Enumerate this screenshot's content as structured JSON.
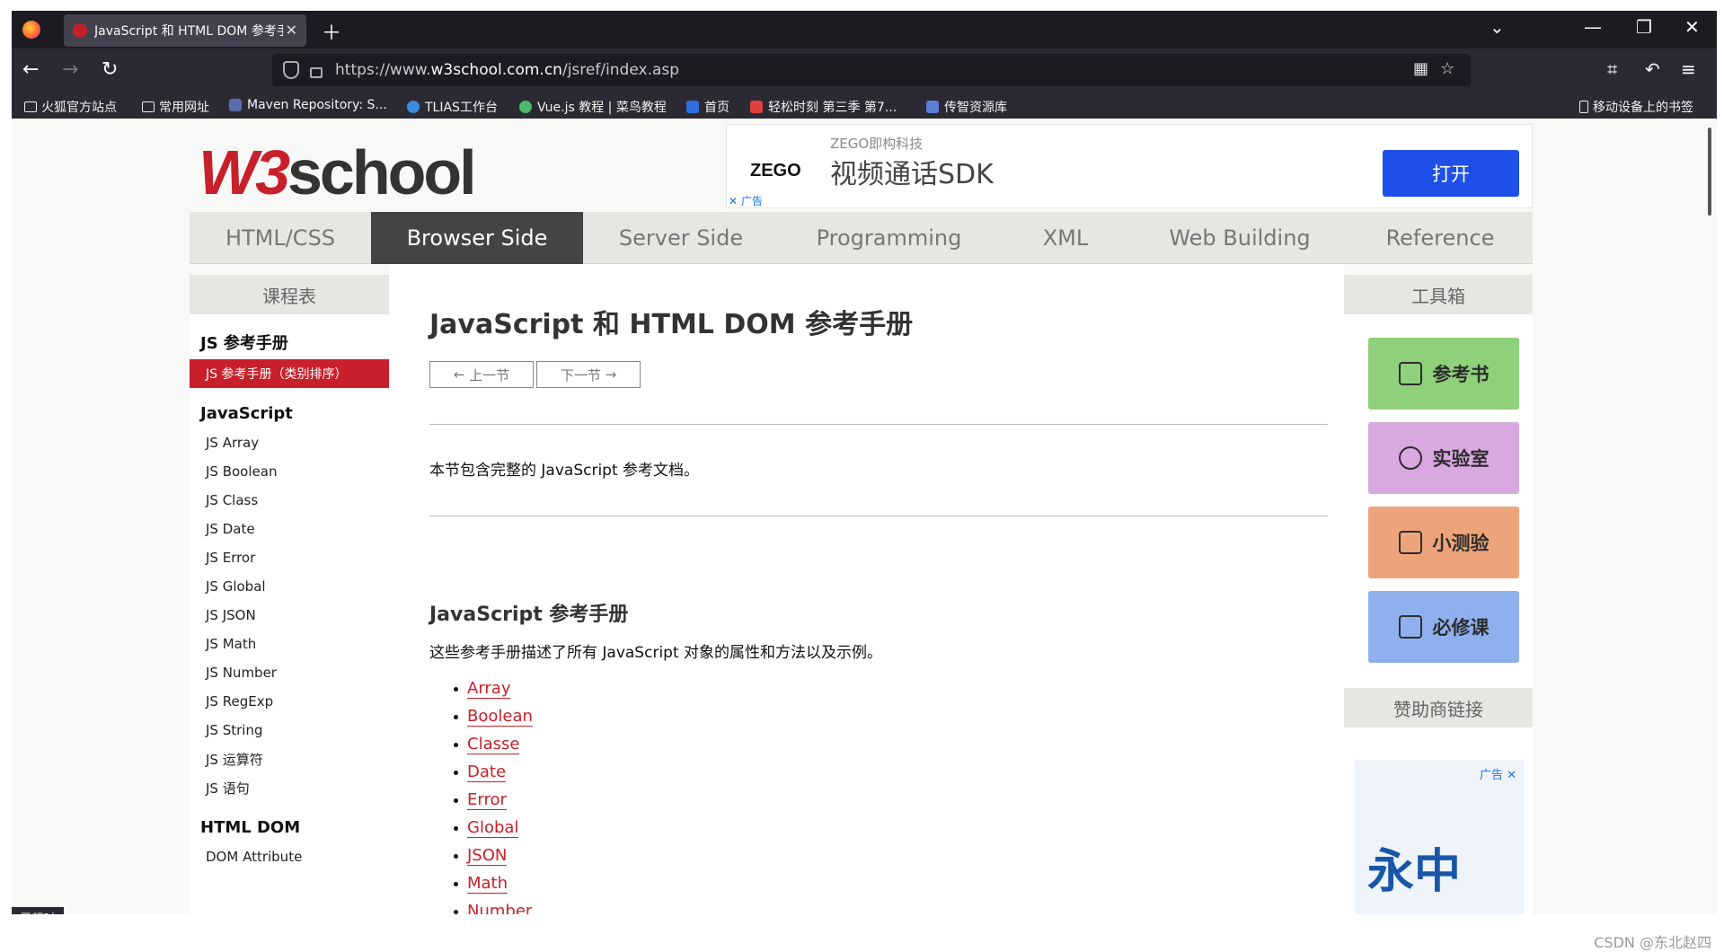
{
  "browser": {
    "tab_title": "JavaScript 和 HTML DOM 参考手册",
    "url_prefix": "https://www.",
    "url_domain": "w3school.com.cn",
    "url_path": "/jsref/index.asp",
    "bookmarks": [
      "火狐官方站点",
      "常用网址",
      "Maven Repository: S...",
      "TLIAS工作台",
      "Vue.js 教程 | 菜鸟教程",
      "首页",
      "轻松时刻 第三季 第7...",
      "传智资源库"
    ],
    "mobile_bookmarks": "移动设备上的书签",
    "colors": {
      "tabbar": "#1c1b22",
      "toolbar": "#2b2a33"
    }
  },
  "site": {
    "logo_w3": "W3",
    "logo_school": "school",
    "nav": [
      "HTML/CSS",
      "Browser Side",
      "Server Side",
      "Programming",
      "XML",
      "Web Building",
      "Reference"
    ],
    "nav_active": "Browser Side",
    "accent": "#c8202a"
  },
  "ad": {
    "logo": "ZEGO",
    "brand": "ZEGO即构科技",
    "slogan": "视频通话SDK",
    "button": "打开",
    "mark": "广告"
  },
  "left_sidebar": {
    "title": "课程表",
    "section1": "JS 参考手册",
    "highlight": "JS 参考手册（类别排序）",
    "section2": "JavaScript",
    "items": [
      "JS Array",
      "JS Boolean",
      "JS Class",
      "JS Date",
      "JS Error",
      "JS Global",
      "JS JSON",
      "JS Math",
      "JS Number",
      "JS RegExp",
      "JS String",
      "JS 运算符",
      "JS 语句"
    ],
    "section3": "HTML DOM",
    "items2": [
      "DOM Attribute"
    ]
  },
  "main": {
    "title": "JavaScript 和 HTML DOM 参考手册",
    "prev": "上一节",
    "next": "下一节",
    "intro": "本节包含完整的 JavaScript 参考文档。",
    "section_title": "JavaScript 参考手册",
    "section_desc": "这些参考手册描述了所有 JavaScript 对象的属性和方法以及示例。",
    "links": [
      "Array",
      "Boolean",
      "Classe",
      "Date",
      "Error",
      "Global",
      "JSON",
      "Math",
      "Number"
    ]
  },
  "right_sidebar": {
    "title": "工具箱",
    "tools": [
      {
        "label": "参考书",
        "color": "#8fd07a"
      },
      {
        "label": "实验室",
        "color": "#d9a8e0"
      },
      {
        "label": "小测验",
        "color": "#eea47a"
      },
      {
        "label": "必修课",
        "color": "#8fb0ee"
      }
    ],
    "sponsor_title": "赞助商链接",
    "sponsor_ad": "广告",
    "sponsor_text": "永中"
  },
  "status": "已超时",
  "watermark": "CSDN @东北赵四"
}
